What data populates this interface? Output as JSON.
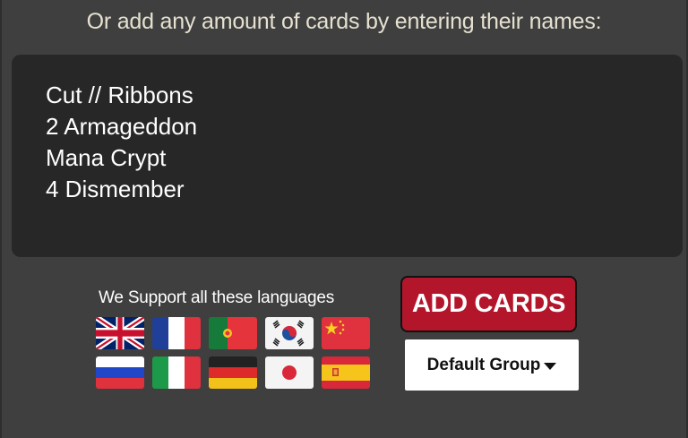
{
  "heading": "Or add any amount of cards by entering their names:",
  "card_input": {
    "value": "Cut // Ribbons\n2 Armageddon\nMana Crypt\n4 Dismember"
  },
  "languages": {
    "title": "We Support all these languages",
    "flags": [
      {
        "icon": "uk-flag-icon"
      },
      {
        "icon": "france-flag-icon"
      },
      {
        "icon": "portugal-flag-icon"
      },
      {
        "icon": "south-korea-flag-icon"
      },
      {
        "icon": "china-flag-icon"
      },
      {
        "icon": "russia-flag-icon"
      },
      {
        "icon": "italy-flag-icon"
      },
      {
        "icon": "germany-flag-icon"
      },
      {
        "icon": "japan-flag-icon"
      },
      {
        "icon": "spain-flag-icon"
      }
    ]
  },
  "add_button": {
    "label": "ADD CARDS",
    "color": "#b3162b"
  },
  "group_select": {
    "value": "Default Group"
  },
  "colors": {
    "background": "#3f3f3f",
    "input_background": "#272727",
    "heading_text": "#e6e1d0"
  }
}
